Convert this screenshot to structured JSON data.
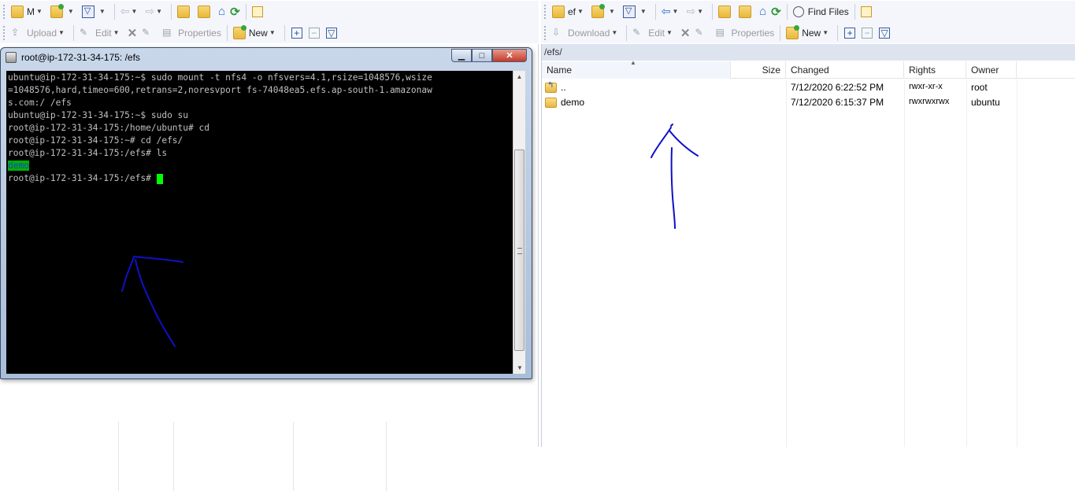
{
  "left_toolbar_top": {
    "drive_label": "M"
  },
  "left_toolbar_bottom": {
    "upload_label": "Upload",
    "edit_label": "Edit",
    "properties_label": "Properties",
    "new_label": "New"
  },
  "right_toolbar_top": {
    "drive_label": "ef",
    "find_files_label": "Find Files"
  },
  "right_toolbar_bottom": {
    "download_label": "Download",
    "edit_label": "Edit",
    "properties_label": "Properties",
    "new_label": "New"
  },
  "terminal": {
    "title": "root@ip-172-31-34-175: /efs",
    "lines": [
      "ubuntu@ip-172-31-34-175:~$ sudo mount -t nfs4 -o nfsvers=4.1,rsize=1048576,wsize",
      "=1048576,hard,timeo=600,retrans=2,noresvport fs-74048ea5.efs.ap-south-1.amazonaw",
      "s.com:/ /efs",
      "ubuntu@ip-172-31-34-175:~$ sudo su",
      "root@ip-172-31-34-175:/home/ubuntu# cd",
      "root@ip-172-31-34-175:~# cd /efs/",
      "root@ip-172-31-34-175:/efs# ls"
    ],
    "ls_output": "demo",
    "prompt": "root@ip-172-31-34-175:/efs# "
  },
  "remote": {
    "path": "/efs/",
    "columns": {
      "name": "Name",
      "size": "Size",
      "changed": "Changed",
      "rights": "Rights",
      "owner": "Owner"
    },
    "rows": [
      {
        "name": "..",
        "changed": "7/12/2020 6:22:52 PM",
        "rights": "rwxr-xr-x",
        "owner": "root"
      },
      {
        "name": "demo",
        "changed": "7/12/2020 6:15:37 PM",
        "rights": "rwxrwxrwx",
        "owner": "ubuntu"
      }
    ]
  },
  "colors": {
    "terminal_bg": "#000000",
    "terminal_fg": "#c0c0c0",
    "highlight_bg": "#00b000",
    "annotation_ink": "#1010c8"
  }
}
